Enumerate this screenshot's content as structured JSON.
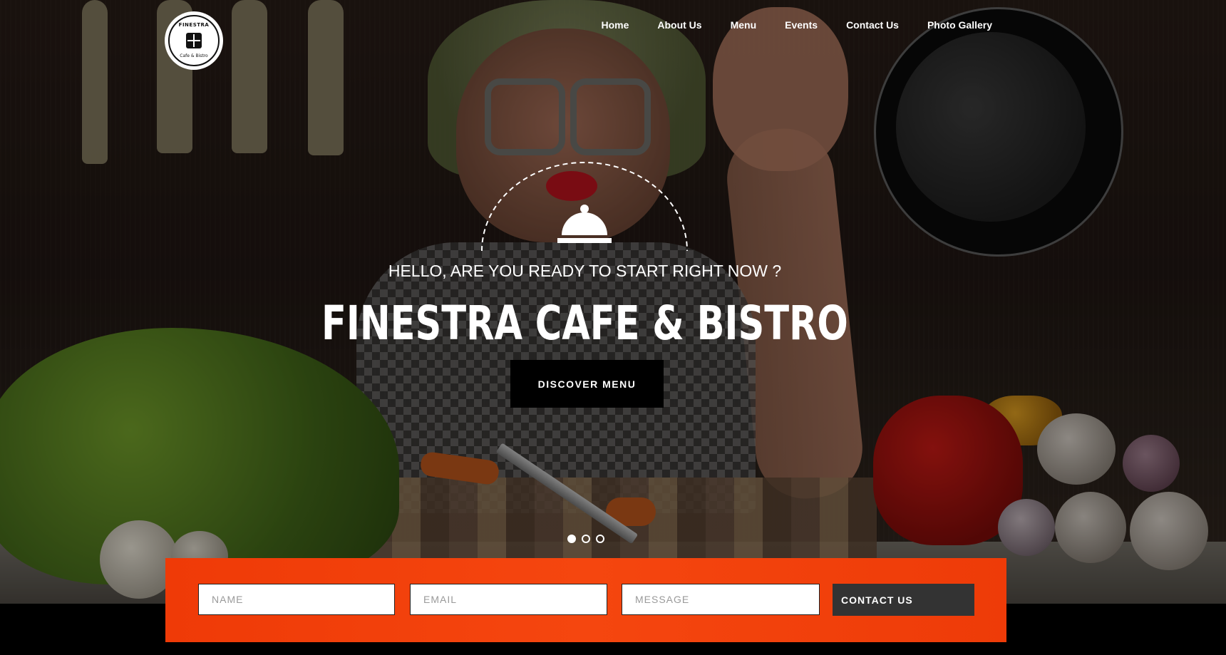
{
  "brand": {
    "logo_top": "FINESTRA",
    "logo_bottom": "Cafe & Bistro"
  },
  "nav": {
    "items": [
      {
        "label": "Home"
      },
      {
        "label": "About Us"
      },
      {
        "label": "Menu"
      },
      {
        "label": "Events"
      },
      {
        "label": "Contact Us"
      },
      {
        "label": "Photo Gallery"
      }
    ]
  },
  "hero": {
    "subtitle": "HELLO, ARE YOU READY TO START RIGHT NOW ?",
    "title": "FINESTRA CAFE & BISTRO",
    "cta_label": "DISCOVER MENU",
    "icon": "cloche-icon",
    "slider": {
      "count": 3,
      "active": 1
    }
  },
  "contact_form": {
    "name_placeholder": "NAME",
    "email_placeholder": "EMAIL",
    "message_placeholder": "MESSAGE",
    "submit_label": "CONTACT US"
  },
  "colors": {
    "accent": "#f24009",
    "button_dark": "#000000",
    "submit_bg": "#333333"
  }
}
